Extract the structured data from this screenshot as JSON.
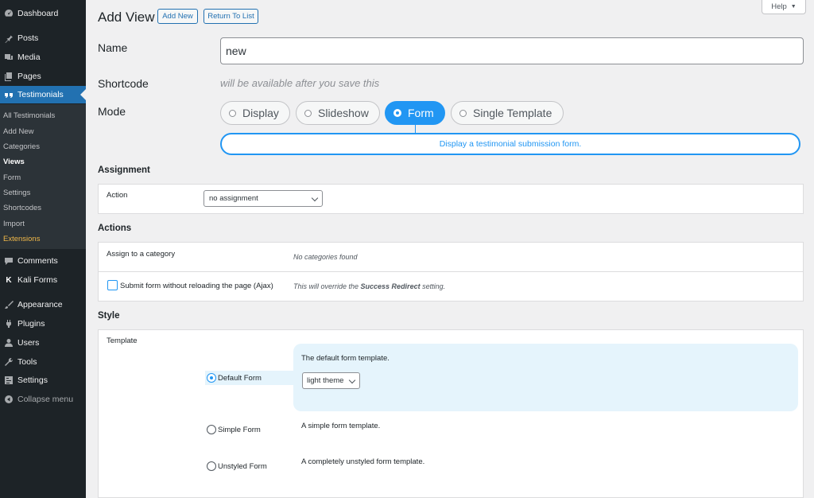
{
  "sidebar": {
    "top": [
      {
        "label": "Dashboard",
        "icon": "dashboard-icon"
      },
      {
        "label": "Posts",
        "icon": "pin-icon"
      },
      {
        "label": "Media",
        "icon": "media-icon"
      },
      {
        "label": "Pages",
        "icon": "pages-icon"
      },
      {
        "label": "Testimonials",
        "icon": "quote-icon"
      }
    ],
    "submenu": [
      "All Testimonials",
      "Add New",
      "Categories",
      "Views",
      "Form",
      "Settings",
      "Shortcodes",
      "Import",
      "Extensions"
    ],
    "bottom": [
      {
        "label": "Comments",
        "icon": "comment-icon"
      },
      {
        "label": "Kali Forms",
        "icon": "kali-forms-icon"
      },
      {
        "label": "Appearance",
        "icon": "brush-icon"
      },
      {
        "label": "Plugins",
        "icon": "plugin-icon"
      },
      {
        "label": "Users",
        "icon": "user-icon"
      },
      {
        "label": "Tools",
        "icon": "wrench-icon"
      },
      {
        "label": "Settings",
        "icon": "settings-icon"
      },
      {
        "label": "Collapse menu",
        "icon": "collapse-icon"
      }
    ],
    "kali_glyph": "K"
  },
  "help": {
    "label": "Help"
  },
  "header": {
    "title": "Add View",
    "add_new": "Add New",
    "return": "Return To List"
  },
  "fields": {
    "name_label": "Name",
    "name_value": "new",
    "shortcode_label": "Shortcode",
    "shortcode_note": "will be available after you save this",
    "mode_label": "Mode",
    "modes": [
      "Display",
      "Slideshow",
      "Form",
      "Single Template"
    ],
    "selected_mode": "Form",
    "mode_description": "Display a testimonial submission form."
  },
  "assignment": {
    "heading": "Assignment",
    "action_label": "Action",
    "action_value": "no assignment"
  },
  "actions": {
    "heading": "Actions",
    "category_label": "Assign to a category",
    "category_note": "No categories found",
    "ajax_label": "Submit form without reloading the page (Ajax)",
    "ajax_note_pre": "This will override the ",
    "ajax_note_bold": "Success Redirect",
    "ajax_note_post": " setting."
  },
  "style": {
    "heading": "Style",
    "template_label": "Template",
    "templates": [
      {
        "label": "Default Form",
        "desc": "The default form template."
      },
      {
        "label": "Simple Form",
        "desc": "A simple form template."
      },
      {
        "label": "Unstyled Form",
        "desc": "A completely unstyled form template."
      }
    ],
    "selected_template": "Default Form",
    "theme_value": "light theme"
  },
  "colors": {
    "accent": "#2196f3",
    "wp_blue": "#2271b1",
    "sidebar_bg": "#1d2327",
    "highlight": "#f0b849"
  }
}
